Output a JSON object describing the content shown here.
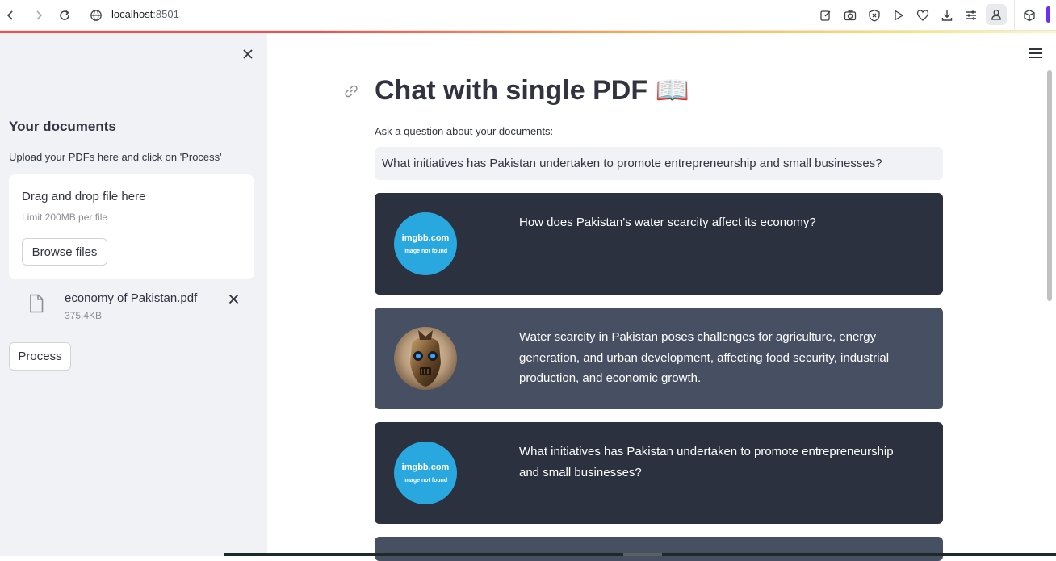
{
  "browser": {
    "url_host": "localhost",
    "url_port": ":8501"
  },
  "sidebar": {
    "heading": "Your documents",
    "instructions": "Upload your PDFs here and click on 'Process'",
    "uploader": {
      "drop_label": "Drag and drop file here",
      "limit": "Limit 200MB per file",
      "browse_label": "Browse files"
    },
    "file": {
      "name": "economy of Pakistan.pdf",
      "size": "375.4KB"
    },
    "process_label": "Process"
  },
  "main": {
    "title": "Chat with single PDF 📖",
    "question_label": "Ask a question about your documents:",
    "question_value": "What initiatives has Pakistan undertaken to promote entrepreneurship and small businesses?",
    "messages": [
      {
        "role": "user",
        "avatar_brand": "imgbb.com",
        "avatar_note": "image not found",
        "text": "How does Pakistan's water scarcity affect its economy?"
      },
      {
        "role": "bot",
        "text": "Water scarcity in Pakistan poses challenges for agriculture, energy generation, and urban development, affecting food security, industrial production, and economic growth."
      },
      {
        "role": "user",
        "avatar_brand": "imgbb.com",
        "avatar_note": "image not found",
        "text": "What initiatives has Pakistan undertaken to promote entrepreneurship and small businesses?"
      }
    ]
  },
  "colors": {
    "sidebar_bg": "#f0f2f6",
    "user_msg_bg": "#2b313e",
    "bot_msg_bg": "#475063",
    "imgbb_avatar": "#29a8e0",
    "accent_purple": "#6b2ff0"
  }
}
